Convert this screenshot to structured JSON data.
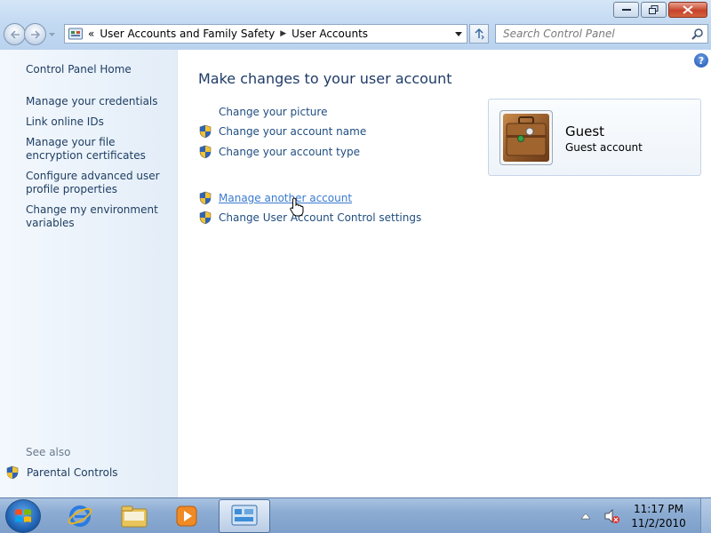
{
  "window": {
    "controls": [
      "minimize",
      "restore",
      "close"
    ]
  },
  "address_bar": {
    "overflow": "«",
    "breadcrumbs": [
      "User Accounts and Family Safety",
      "User Accounts"
    ]
  },
  "search": {
    "placeholder": "Search Control Panel"
  },
  "left_pane": {
    "home": "Control Panel Home",
    "links": [
      "Manage your credentials",
      "Link online IDs",
      "Manage your file encryption certificates",
      "Configure advanced user profile properties",
      "Change my environment variables"
    ],
    "see_also_label": "See also",
    "see_also_links": [
      "Parental Controls"
    ]
  },
  "main": {
    "help": "?",
    "heading": "Make changes to your user account",
    "tasks": [
      "Change your picture",
      "Change your account name",
      "Change your account type"
    ],
    "more_tasks": [
      "Manage another account",
      "Change User Account Control settings"
    ]
  },
  "account": {
    "name": "Guest",
    "type": "Guest account"
  },
  "taskbar": {
    "apps": [
      "start-orb",
      "internet-explorer",
      "windows-explorer",
      "media-player",
      "control-panel"
    ],
    "clock_time": "11:17 PM",
    "clock_date": "11/2/2010"
  },
  "colors": {
    "link": "#1f4d80",
    "link_hover": "#3a7ad0",
    "heading": "#1e3b67"
  }
}
